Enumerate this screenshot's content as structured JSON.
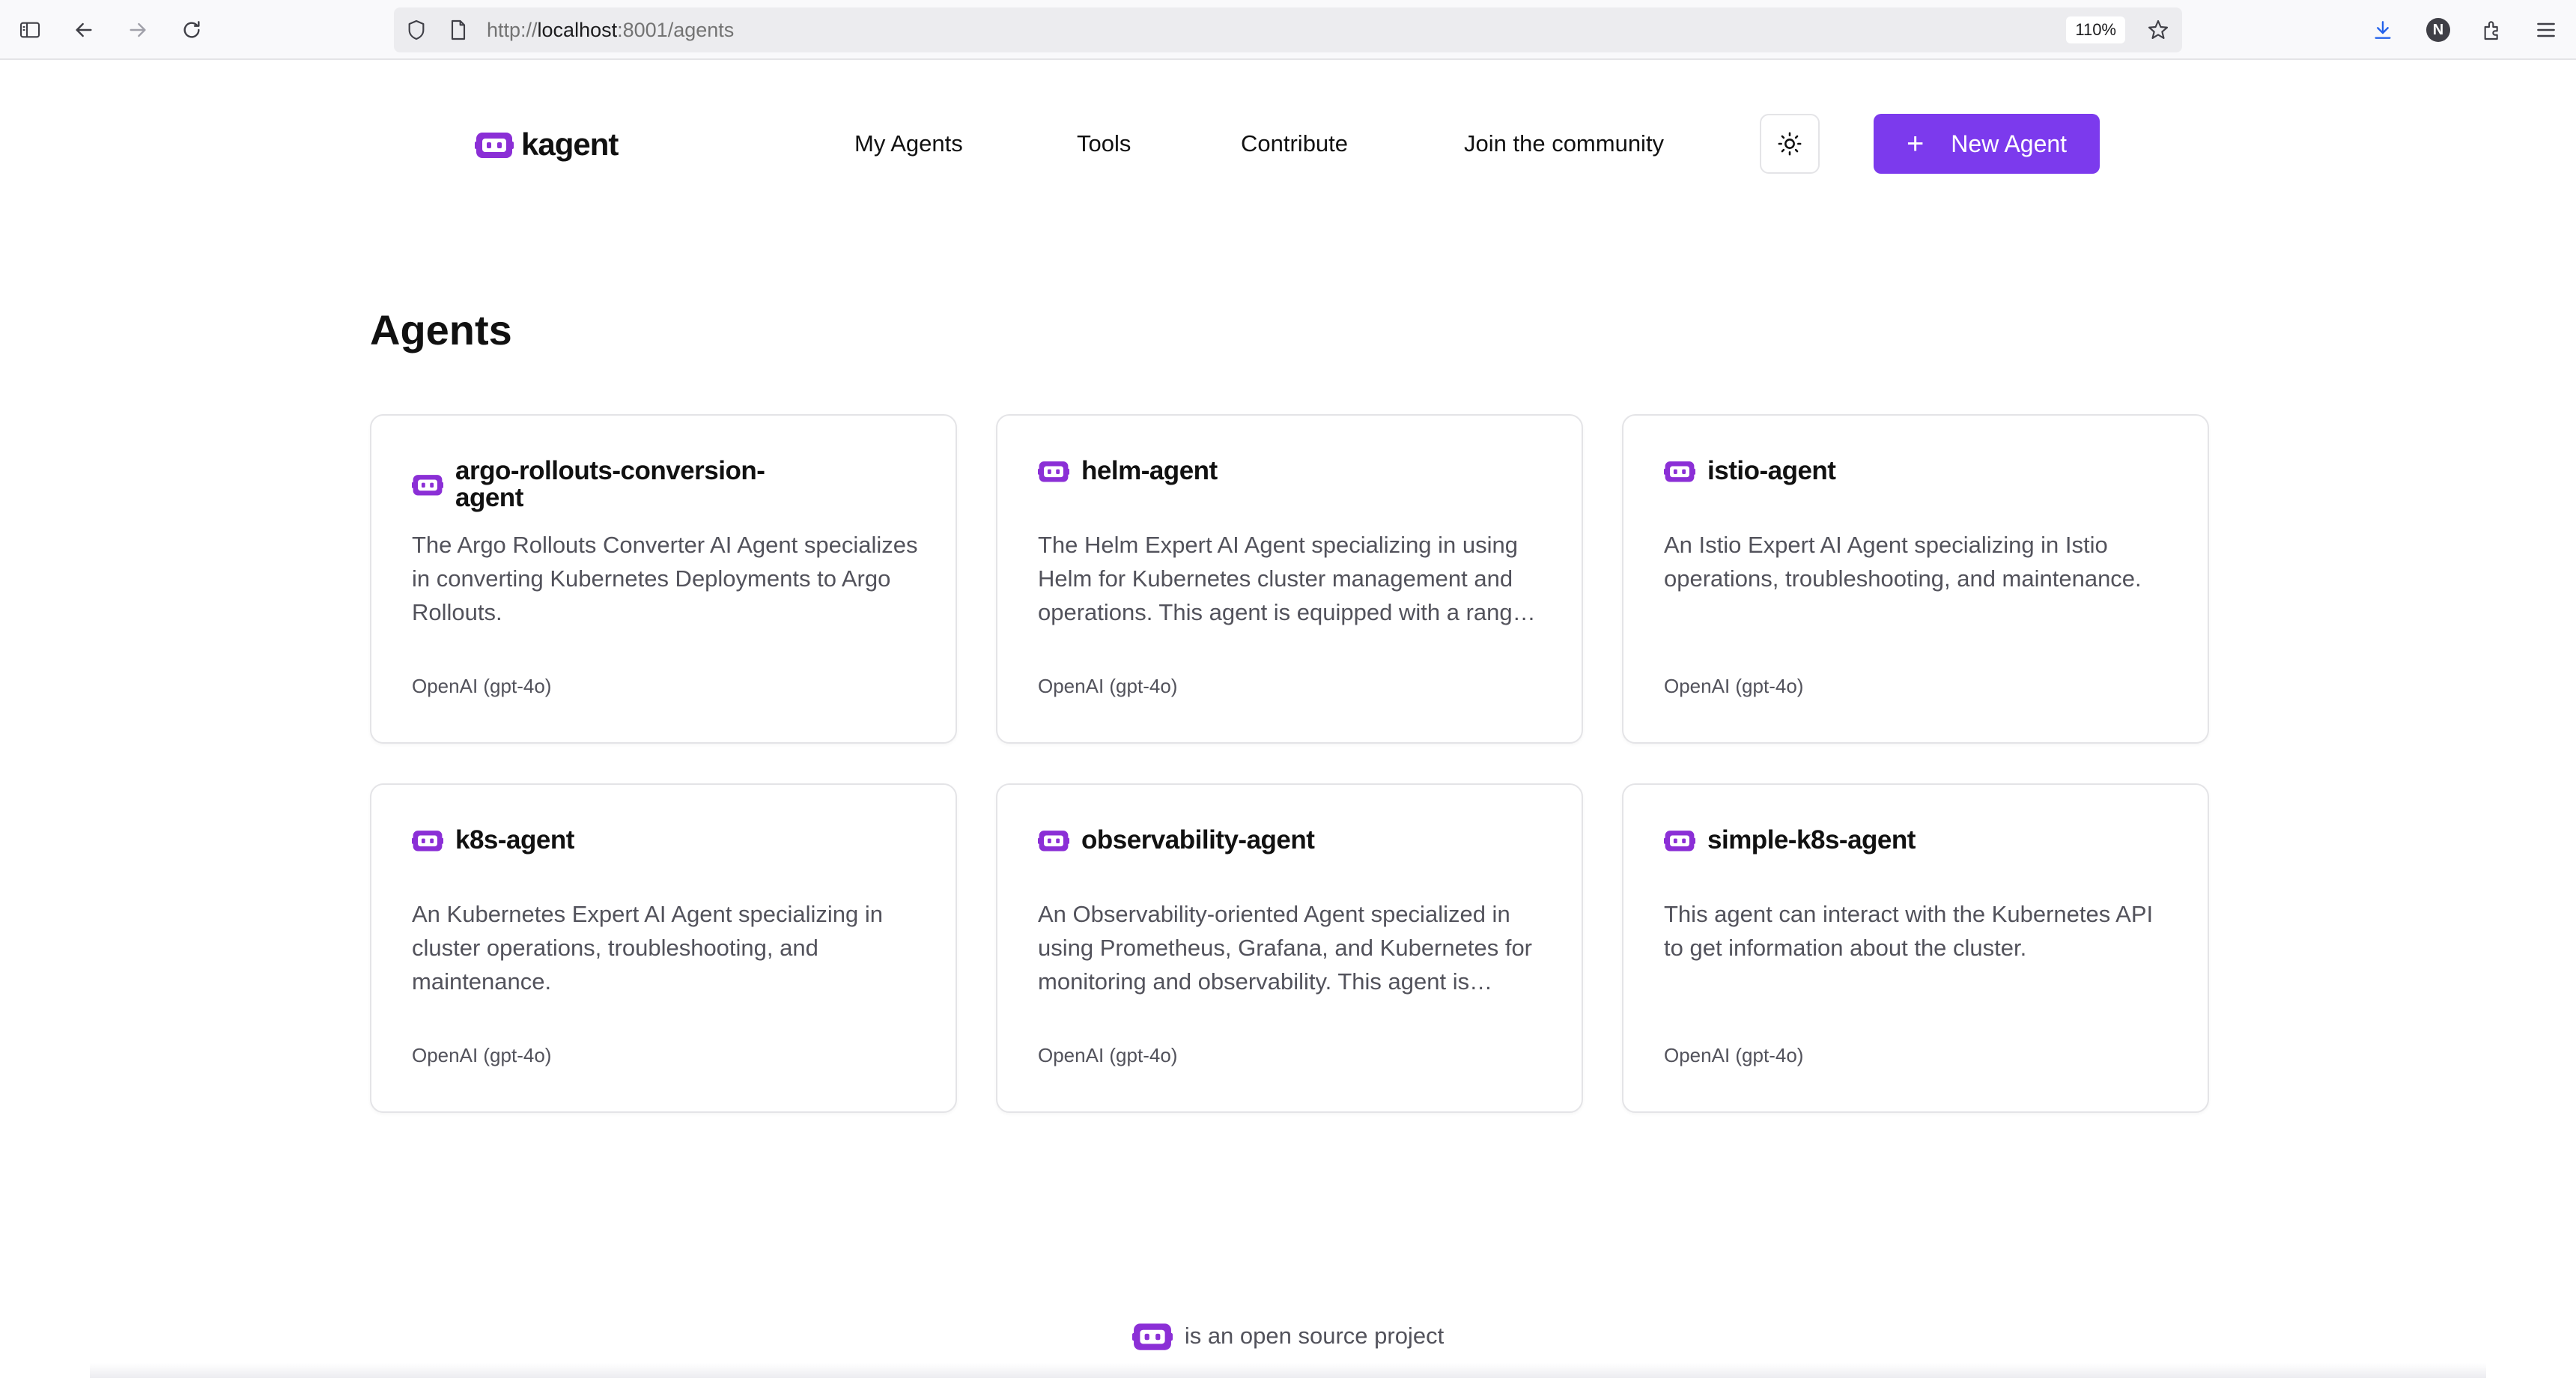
{
  "browser": {
    "url_prefix": "http://",
    "url_host": "localhost",
    "url_rest": ":8001/agents",
    "zoom": "110%",
    "profile_initial": "N"
  },
  "header": {
    "logo_text": "kagent",
    "nav": [
      {
        "label": "My Agents"
      },
      {
        "label": "Tools"
      },
      {
        "label": "Contribute"
      },
      {
        "label": "Join the community"
      }
    ],
    "new_agent_label": "New Agent"
  },
  "main": {
    "title": "Agents",
    "agents": [
      {
        "name": "argo-rollouts-conversion-agent",
        "description": "The Argo Rollouts Converter AI Agent specializes in converting Kubernetes Deployments to Argo Rollouts.",
        "model": "OpenAI (gpt-4o)"
      },
      {
        "name": "helm-agent",
        "description": "The Helm Expert AI Agent specializing in using Helm for Kubernetes cluster management and operations. This agent is equipped with a range of tools to help manage Helm releases.",
        "model": "OpenAI (gpt-4o)"
      },
      {
        "name": "istio-agent",
        "description": "An Istio Expert AI Agent specializing in Istio operations, troubleshooting, and maintenance.",
        "model": "OpenAI (gpt-4o)"
      },
      {
        "name": "k8s-agent",
        "description": "An Kubernetes Expert AI Agent specializing in cluster operations, troubleshooting, and maintenance.",
        "model": "OpenAI (gpt-4o)"
      },
      {
        "name": "observability-agent",
        "description": "An Observability-oriented Agent specialized in using Prometheus, Grafana, and Kubernetes for monitoring and observability. This agent is equipped with a range of tools.",
        "model": "OpenAI (gpt-4o)"
      },
      {
        "name": "simple-k8s-agent",
        "description": "This agent can interact with the Kubernetes API to get information about the cluster.",
        "model": "OpenAI (gpt-4o)"
      }
    ]
  },
  "footer": {
    "text": "is an open source project"
  },
  "colors": {
    "brand": "#7c3aed",
    "icon_purple": "#8b2fd6"
  },
  "icons": [
    "sidebar-icon",
    "back-arrow-icon",
    "forward-arrow-icon",
    "reload-icon",
    "shield-icon",
    "page-icon",
    "star-icon",
    "download-icon",
    "extensions-icon",
    "menu-icon",
    "robot-icon",
    "sun-icon",
    "plus-icon"
  ]
}
